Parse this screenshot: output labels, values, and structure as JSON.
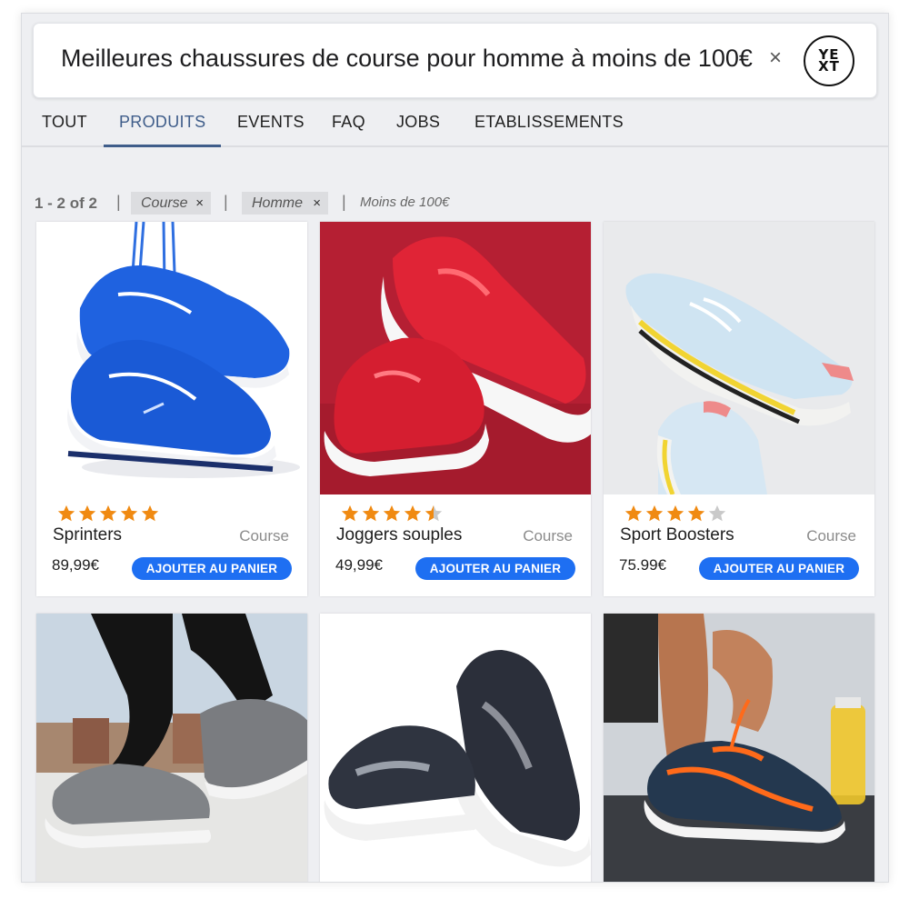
{
  "search": {
    "query": "Meilleures chaussures de course pour homme à moins de 100€",
    "clear_label": "×"
  },
  "brand": {
    "logo_line1": "YE",
    "logo_line2": "XT"
  },
  "tabs": [
    {
      "label": "TOUT",
      "active": false
    },
    {
      "label": "PRODUITS",
      "active": true
    },
    {
      "label": "EVENTS",
      "active": false
    },
    {
      "label": "FAQ",
      "active": false
    },
    {
      "label": "JOBS",
      "active": false
    },
    {
      "label": "ETABLISSEMENTS",
      "active": false
    }
  ],
  "filters": {
    "count": "1 - 2 of 2",
    "separator": "|",
    "chips": [
      {
        "label": "Course",
        "remove": "×"
      },
      {
        "label": "Homme",
        "remove": "×"
      }
    ],
    "text": "Moins de 100€"
  },
  "products": [
    {
      "name": "Sprinters",
      "category": "Course",
      "price": "89,99€",
      "rating": 5,
      "button": "AJOUTER AU PANIER",
      "image": "blue-running-shoes-hanging-by-laces"
    },
    {
      "name": "Joggers souples",
      "category": "Course",
      "price": "49,99€",
      "rating": 4.5,
      "button": "AJOUTER AU PANIER",
      "image": "red-mesh-sneakers-on-red-background"
    },
    {
      "name": "Sport Boosters",
      "category": "Course",
      "price": "75.99€",
      "rating": 4,
      "button": "AJOUTER AU PANIER",
      "image": "light-blue-white-sneakers-yellow-sole"
    }
  ],
  "more_products": [
    {
      "image": "runner-legs-grey-sneakers"
    },
    {
      "image": "black-white-knit-sneakers"
    },
    {
      "image": "tying-orange-laces-navy-sneaker"
    }
  ],
  "colors": {
    "accent": "#1e6ff2",
    "tab_active": "#3f5d8a",
    "star": "#f08a12",
    "star_empty": "#c9c9c9"
  }
}
